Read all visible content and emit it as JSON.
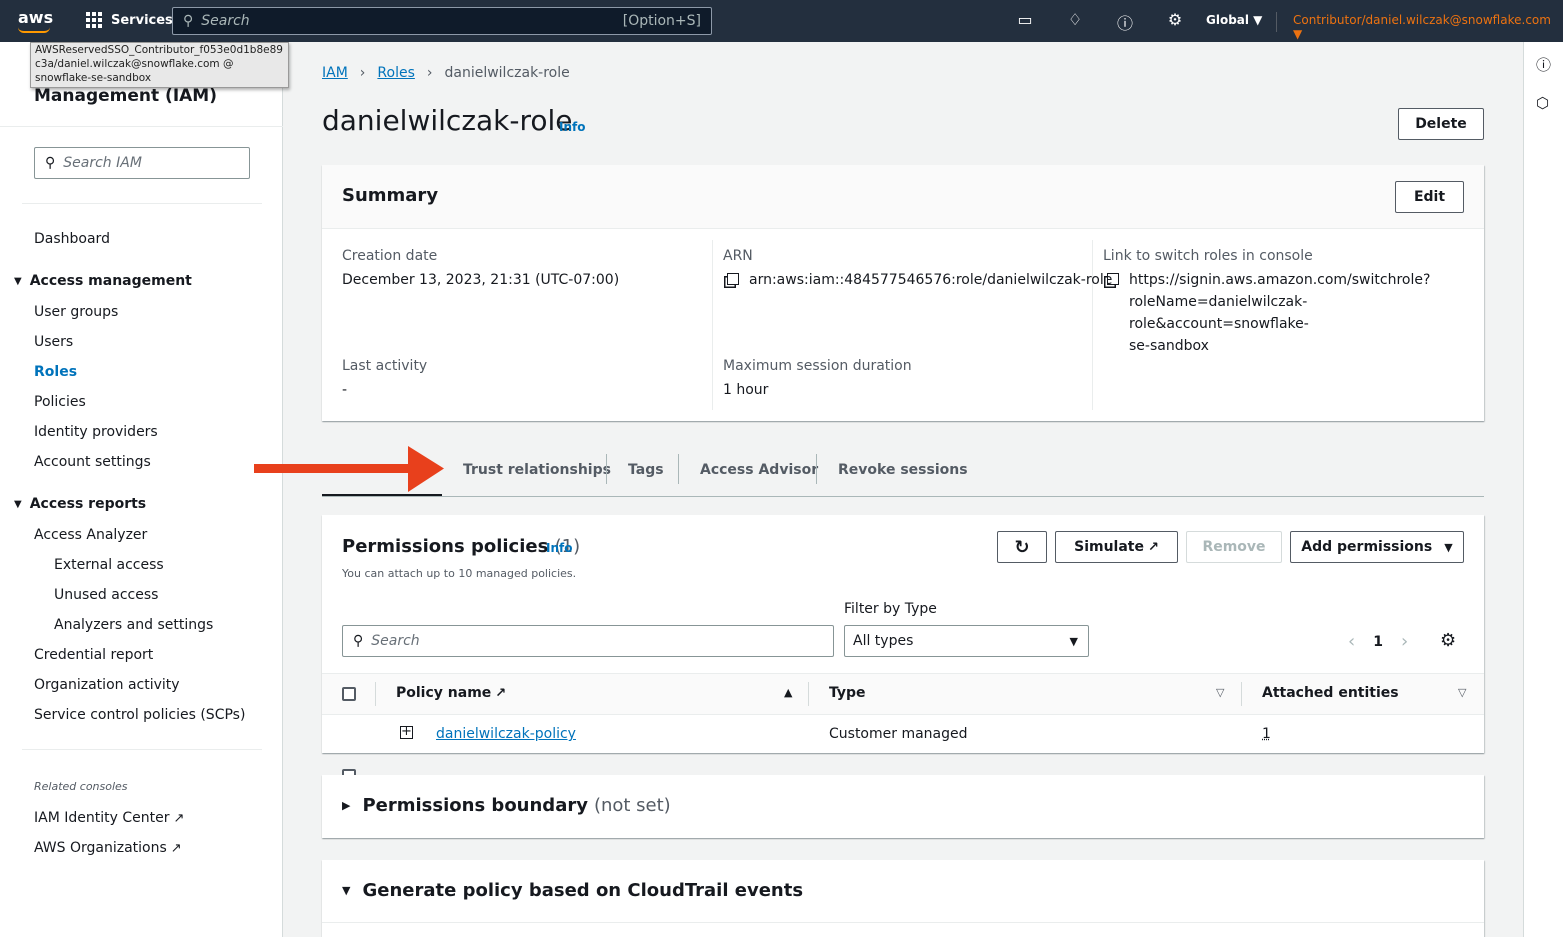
{
  "topnav": {
    "logo": "aws",
    "services_label": "Services",
    "search_placeholder": "Search",
    "search_shortcut": "[Option+S]",
    "icons": [
      "cloudshell-icon",
      "bell-icon",
      "help-icon",
      "settings-icon"
    ],
    "region": "Global ▼",
    "account": "Contributor/daniel.wilczak@snowflake.com ▼"
  },
  "tooltip": {
    "line1": "AWSReservedSSO_Contributor_f053e0d1b8e89",
    "line2": "c3a/daniel.wilczak@snowflake.com @",
    "line3": "snowflake-se-sandbox"
  },
  "sidebar": {
    "title": "Management (IAM)",
    "search_placeholder": "Search IAM",
    "dashboard": "Dashboard",
    "access_management": "Access management",
    "am_items": [
      "User groups",
      "Users",
      "Roles",
      "Policies",
      "Identity providers",
      "Account settings"
    ],
    "access_reports": "Access reports",
    "ar_items": [
      "Access Analyzer",
      "External access",
      "Unused access",
      "Analyzers and settings",
      "Credential report",
      "Organization activity",
      "Service control policies (SCPs)"
    ],
    "related_label": "Related consoles",
    "related_items": [
      "IAM Identity Center",
      "AWS Organizations"
    ]
  },
  "breadcrumb": [
    "IAM",
    "Roles",
    "danielwilczak-role"
  ],
  "page": {
    "title": "danielwilczak-role",
    "info": "Info",
    "delete_label": "Delete"
  },
  "summary": {
    "title": "Summary",
    "edit_label": "Edit",
    "creation_date_label": "Creation date",
    "creation_date": "December 13, 2023, 21:31 (UTC-07:00)",
    "arn_label": "ARN",
    "arn": "arn:aws:iam::484577546576:role/danielwilczak-role",
    "link_label": "Link to switch roles in console",
    "link_line1": "https://signin.aws.amazon.com/switchrole?",
    "link_line2": "roleName=danielwilczak-role&account=snowflake-",
    "link_line3": "se-sandbox",
    "last_activity_label": "Last activity",
    "last_activity": "-",
    "max_session_label": "Maximum session duration",
    "max_session": "1 hour"
  },
  "tabs": [
    "Trust relationships",
    "Tags",
    "Access Advisor",
    "Revoke sessions"
  ],
  "permissions": {
    "title": "Permissions policies",
    "count": "(1)",
    "info": "Info",
    "description": "You can attach up to 10 managed policies.",
    "simulate_label": "Simulate",
    "remove_label": "Remove",
    "add_label": "Add permissions",
    "filter_label": "Filter by Type",
    "search_placeholder": "Search",
    "filter_value": "All types",
    "page": "1",
    "columns": [
      "Policy name",
      "Type",
      "Attached entities"
    ],
    "rows": [
      {
        "name": "danielwilczak-policy",
        "type": "Customer managed",
        "entities": "1"
      }
    ]
  },
  "boundary": {
    "title": "Permissions boundary",
    "status": "(not set)"
  },
  "cloudtrail": {
    "title": "Generate policy based on CloudTrail events"
  },
  "colors": {
    "nav_bg": "#232f3e",
    "link": "#0073bb",
    "account": "#ec7211",
    "annotation_arrow": "#e8401c"
  }
}
